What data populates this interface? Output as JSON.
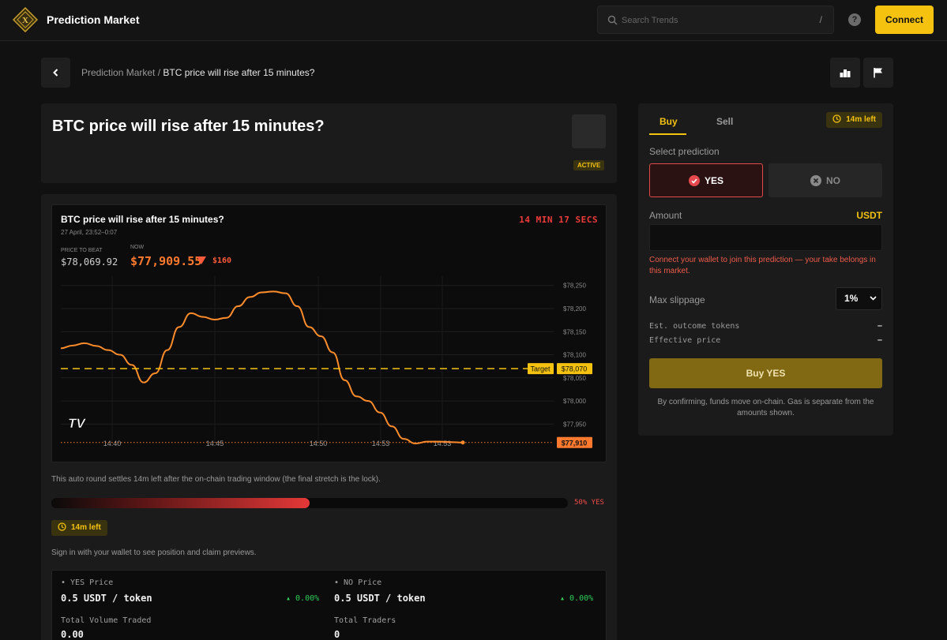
{
  "header": {
    "logo_letter": "X",
    "brand": "Prediction Market",
    "search_placeholder": "Search Trends",
    "search_shortcut": "/",
    "help_label": "?",
    "connect_label": "Connect"
  },
  "breadcrumb": {
    "root": "Prediction Market",
    "separator": " / ",
    "current": "BTC price will rise after 15 minutes?"
  },
  "market": {
    "title": "BTC price will rise after 15 minutes?",
    "status": "ACTIVE"
  },
  "chart_card": {
    "title": "BTC price will rise after 15 minutes?",
    "date_range": "27 April, 23:52–0:07",
    "countdown": "14 MIN 17 SECS",
    "price_to_beat_label": "PRICE TO BEAT",
    "price_to_beat": "$78,069.92",
    "now_label": "NOW",
    "now_price": "$77,909.55",
    "now_delta": "$160"
  },
  "chart_data": {
    "type": "line",
    "x_ticks": [
      "14:40",
      "14:45",
      "14:50",
      "14:53",
      "14:53"
    ],
    "y_ticks": [
      "$78,250",
      "$78,200",
      "$78,150",
      "$78,100",
      "$78,050",
      "$78,000",
      "$77,950"
    ],
    "ylim": [
      77925,
      78270
    ],
    "series": [
      {
        "values": [
          78114,
          78120,
          78125,
          78119,
          78110,
          78100,
          78078,
          78040,
          78060,
          78110,
          78160,
          78190,
          78182,
          78176,
          78180,
          78205,
          78225,
          78235,
          78237,
          78233,
          78205,
          78160,
          78140,
          78105,
          78045,
          78010,
          78000,
          77975,
          77945,
          77918,
          77908,
          77912,
          77912,
          77911,
          77910
        ]
      }
    ],
    "target_label": "Target",
    "target_value": 78070,
    "target_tag": "$78,070",
    "current_value": 77910,
    "current_tag": "$77,910",
    "watermark": "TV",
    "grid": true,
    "colors": {
      "line": "#ff8c2a",
      "target": "#f4c20f",
      "current_tag": "#ff7a2f"
    }
  },
  "round": {
    "settle_text": "This auto round settles 14m left after the on-chain trading window (the final stretch is the lock).",
    "progress_fraction": 0.5,
    "progress_label": "50% YES",
    "time_left": "14m left",
    "signin_text": "Sign in with your wallet to see position and claim previews."
  },
  "stats": {
    "yes_price_label": "• YES Price",
    "yes_price": "0.5 USDT / token",
    "yes_change": "▴ 0.00%",
    "no_price_label": "• NO Price",
    "no_price": "0.5 USDT / token",
    "no_change": "▴ 0.00%",
    "volume_label": "Total Volume Traded",
    "volume": "0.00",
    "traders_label": "Total Traders",
    "traders": "0"
  },
  "trade": {
    "tab_buy": "Buy",
    "tab_sell": "Sell",
    "time_left": "14m left",
    "select_label": "Select prediction",
    "yes_label": "YES",
    "no_label": "NO",
    "amount_label": "Amount",
    "amount_unit": "USDT",
    "amount_value": "",
    "warning": "Connect your wallet to join this prediction — your take belongs in this market.",
    "slippage_label": "Max slippage",
    "slippage_value": "1%",
    "est_tokens_label": "Est. outcome tokens",
    "est_tokens_value": "–",
    "effective_price_label": "Effective price",
    "effective_price_value": "–",
    "buy_button": "Buy YES",
    "note": "By confirming, funds move on-chain. Gas is separate from the amounts shown."
  },
  "colors": {
    "accent": "#f4c20f",
    "up": "#2fcf5a",
    "down": "#ef3b3b",
    "price_line": "#ff8c2a"
  }
}
